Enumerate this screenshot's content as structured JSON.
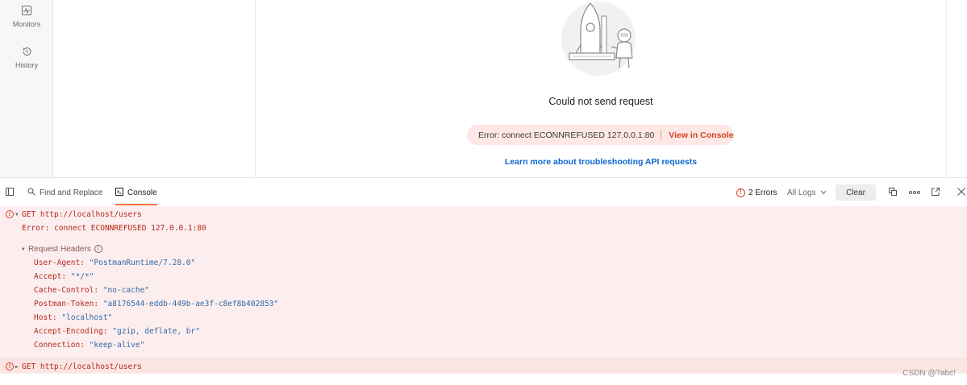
{
  "sidebar": {
    "items": [
      {
        "label": "Monitors",
        "icon": "monitor-icon"
      },
      {
        "label": "History",
        "icon": "history-icon"
      }
    ]
  },
  "response": {
    "message": "Could not send request",
    "error_text": "Error: connect ECONNREFUSED 127.0.0.1:80",
    "view_console_label": "View in Console",
    "learn_more_label": "Learn more about troubleshooting API requests"
  },
  "toolbar": {
    "find_replace_label": "Find and Replace",
    "console_label": "Console",
    "errors_label": "2 Errors",
    "all_logs_label": "All Logs",
    "clear_label": "Clear"
  },
  "console": {
    "entries": [
      {
        "method_url": "GET http://localhost/users",
        "error": "Error: connect ECONNREFUSED 127.0.0.1:80",
        "request_headers_label": "Request Headers",
        "headers": [
          {
            "key": "User-Agent:",
            "value": "\"PostmanRuntime/7.28.0\""
          },
          {
            "key": "Accept:",
            "value": "\"*/*\""
          },
          {
            "key": "Cache-Control:",
            "value": "\"no-cache\""
          },
          {
            "key": "Postman-Token:",
            "value": "\"a8176544-eddb-449b-ae3f-c8ef8b402853\""
          },
          {
            "key": "Host:",
            "value": "\"localhost\""
          },
          {
            "key": "Accept-Encoding:",
            "value": "\"gzip, deflate, br\""
          },
          {
            "key": "Connection:",
            "value": "\"keep-alive\""
          }
        ]
      },
      {
        "method_url": "GET http://localhost/users"
      }
    ]
  },
  "watermark": "CSDN @?abc!",
  "colors": {
    "accent": "#ff6c37",
    "error": "#d14124",
    "link": "#0b66d0",
    "log_background": "#fceeee"
  }
}
